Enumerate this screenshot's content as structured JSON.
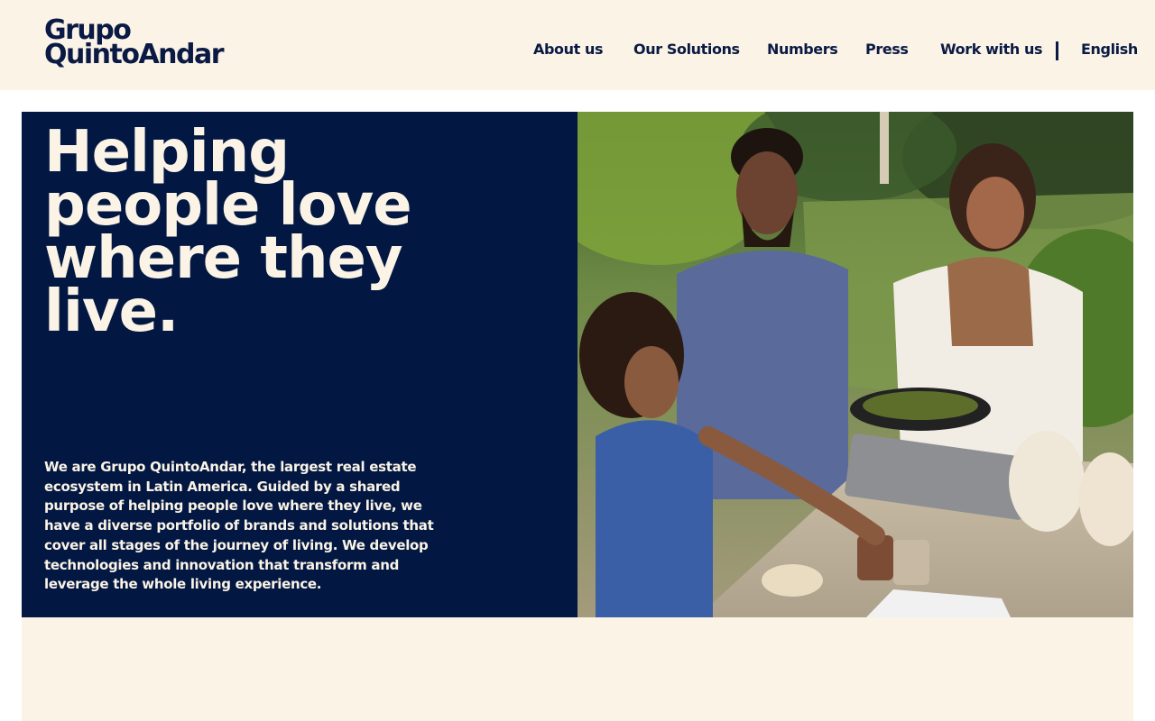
{
  "header": {
    "logo_line1": "Grupo",
    "logo_line2": "QuintoAndar",
    "nav": [
      {
        "label": "About us"
      },
      {
        "label": "Our Solutions"
      },
      {
        "label": "Numbers"
      },
      {
        "label": "Press"
      },
      {
        "label": "Work with us"
      }
    ],
    "language": "English"
  },
  "hero": {
    "title": "Helping people love where they live.",
    "description": "We are Grupo QuintoAndar, the largest real estate ecosystem in Latin America. Guided by a shared purpose of helping people love where they live, we have a diverse portfolio of brands and solutions that cover all stages of the journey of living. We develop technologies and innovation that transform and leverage the whole living experience."
  },
  "colors": {
    "navy": "#021741",
    "cream": "#faf3e6",
    "text_dark": "#0b1a44"
  }
}
